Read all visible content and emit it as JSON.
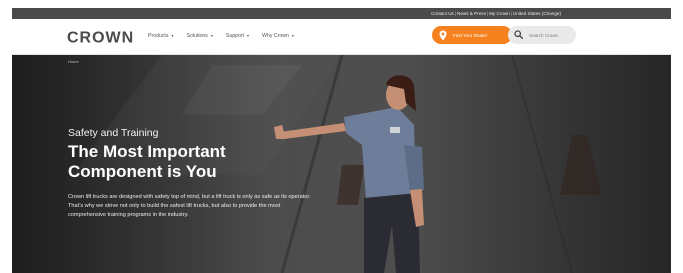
{
  "utility_bar": {
    "links": [
      "Contact Us",
      "News & Press",
      "My Crown",
      "United States (Change)"
    ],
    "separator": "|"
  },
  "header": {
    "logo_text": "CROWN",
    "menu": [
      {
        "label": "Products"
      },
      {
        "label": "Solutions"
      },
      {
        "label": "Support"
      },
      {
        "label": "Why Crown"
      }
    ],
    "dealer_button": "Find Your Dealer",
    "search_placeholder": "Search Crown"
  },
  "hero": {
    "breadcrumb": "Home",
    "eyebrow": "Safety and Training",
    "headline": "The Most Important Component is You",
    "body": "Crown lift trucks are designed with safety top of mind, but a lift truck is only as safe as its operator. That’s why we strive not only to build the safest lift trucks, but also to provide the most comprehensive training programs in the industry."
  },
  "colors": {
    "accent": "#f5821f",
    "utility_bar": "#4a4a4a",
    "nav_bg": "#ffffff",
    "hero_bg": "#3a3a3a"
  },
  "icons": {
    "menu_caret": "▾",
    "dealer": "location-pin-icon",
    "search": "magnifier-icon"
  }
}
